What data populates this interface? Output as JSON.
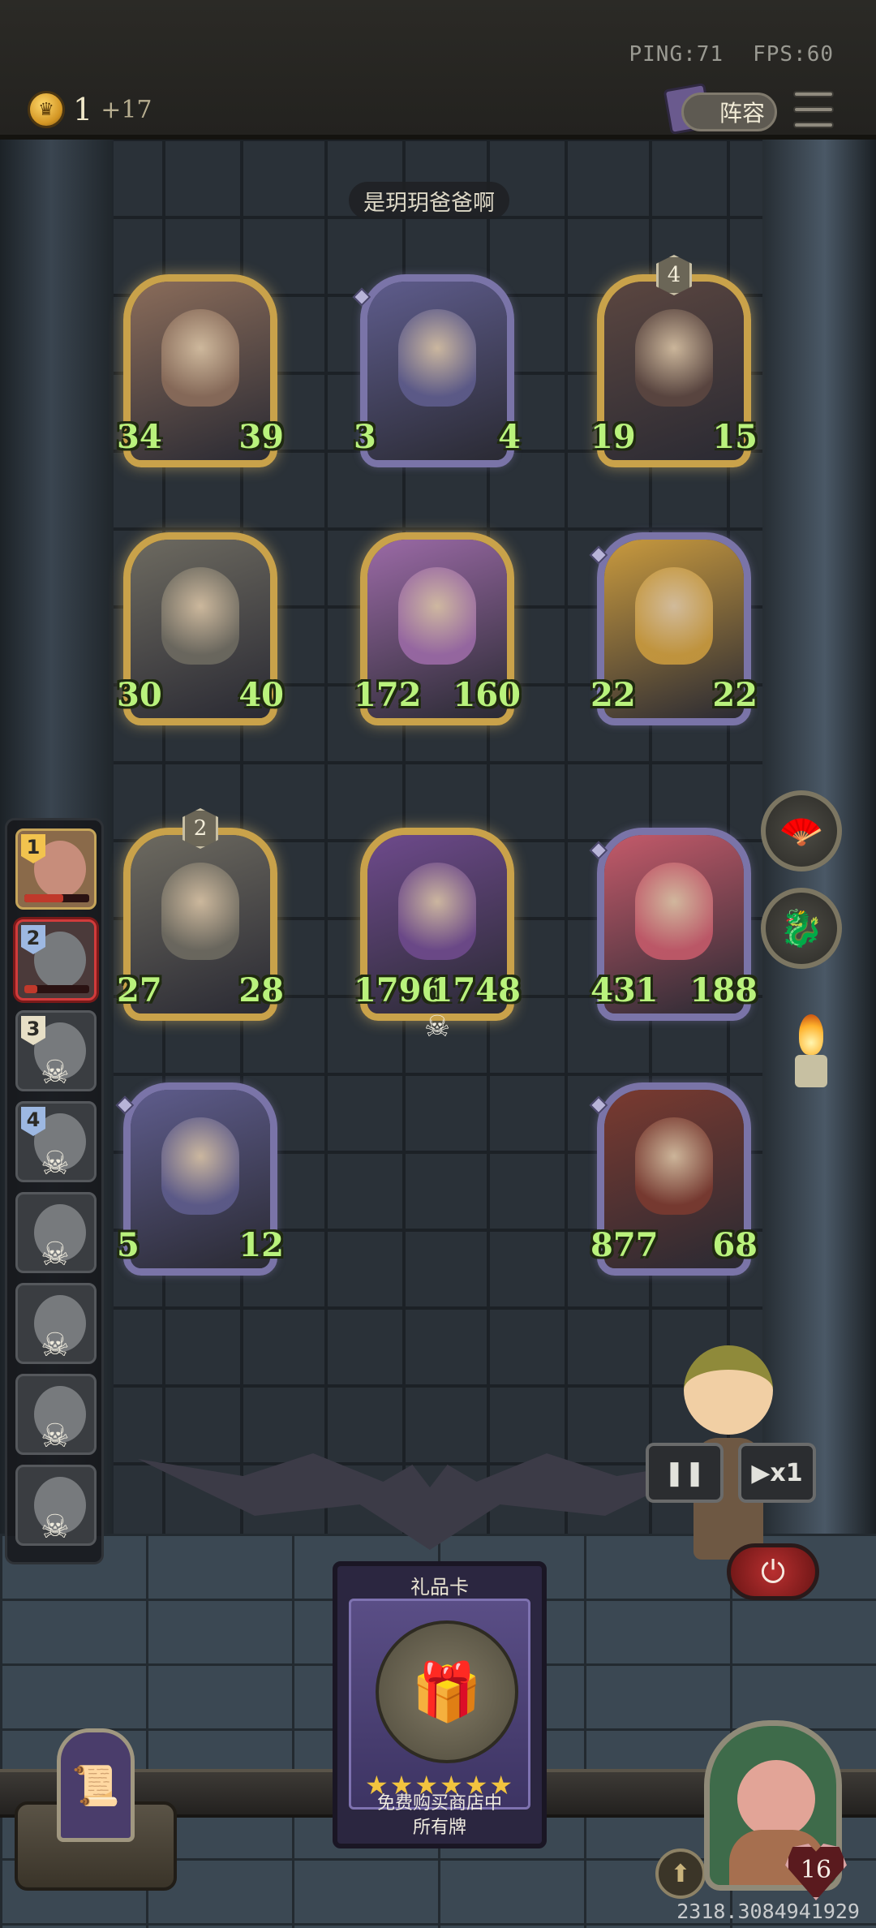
{
  "status": {
    "ping": "PING:71",
    "fps": "FPS:60"
  },
  "gold": {
    "amount": "1",
    "income": "+17"
  },
  "lineup_label": "阵容",
  "opponent_name": "是玥玥爸爸啊",
  "board": [
    {
      "atk": "34",
      "hp": "39",
      "frame": "gold",
      "portrait_color": "#8a6c5a"
    },
    {
      "atk": "3",
      "hp": "4",
      "frame": "silver",
      "portrait_color": "#5e5c8c"
    },
    {
      "atk": "19",
      "hp": "15",
      "frame": "gold",
      "tier": "4",
      "portrait_color": "#5b4640"
    },
    {
      "atk": "30",
      "hp": "40",
      "frame": "gold",
      "portrait_color": "#6d6a60"
    },
    {
      "atk": "172",
      "hp": "160",
      "frame": "gold",
      "portrait_color": "#9b6aa6"
    },
    {
      "atk": "22",
      "hp": "22",
      "frame": "silver",
      "portrait_color": "#c99a3e"
    },
    {
      "atk": "27",
      "hp": "28",
      "frame": "gold",
      "tier": "2",
      "portrait_color": "#6d6a60"
    },
    {
      "atk": "1796",
      "hp": "1748",
      "frame": "gold",
      "portrait_color": "#6e4a8c"
    },
    {
      "atk": "431",
      "hp": "188",
      "frame": "silver",
      "portrait_color": "#c45a6a"
    },
    {
      "atk": "5",
      "hp": "12",
      "frame": "silver",
      "portrait_color": "#5e5c8c"
    },
    {
      "atk": "877",
      "hp": "68",
      "frame": "silver",
      "portrait_color": "#7a3a30"
    }
  ],
  "players": [
    {
      "rank": "1",
      "state": "first",
      "health_fraction": 0.6
    },
    {
      "rank": "2",
      "state": "current",
      "health_fraction": 0.2
    },
    {
      "rank": "3",
      "state": "dead"
    },
    {
      "rank": "4",
      "state": "dead"
    },
    {
      "rank": "",
      "state": "dead"
    },
    {
      "rank": "",
      "state": "dead"
    },
    {
      "rank": "",
      "state": "dead"
    },
    {
      "rank": "",
      "state": "dead"
    }
  ],
  "icons": {
    "skull": "☠",
    "fan": "🪭",
    "dragon": "🐉",
    "pause": "❚❚",
    "speed_icon": "▶",
    "power": "⏻",
    "gift": "🎁",
    "star": "★",
    "scroll": "📜",
    "tier": "⬆"
  },
  "speed_label": "x1",
  "gift_card": {
    "title": "礼品卡",
    "stars": "★★★★★★",
    "desc_line1": "免费购买商店中",
    "desc_line2": "所有牌"
  },
  "health": "16",
  "coordinates": "2318.3084941929",
  "colors": {
    "gold_frame": "#c9a24a",
    "silver_frame": "#7a74a8",
    "stat_green": "#b9f27c"
  }
}
